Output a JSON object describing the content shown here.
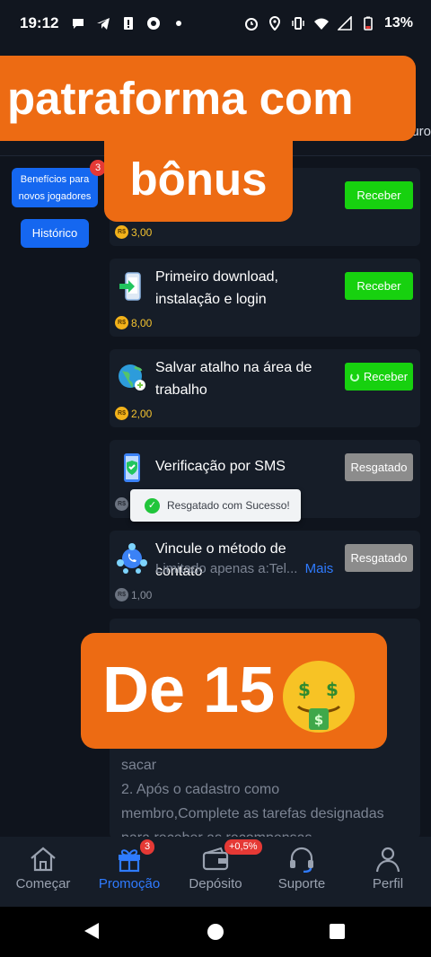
{
  "status_bar": {
    "time": "19:12",
    "battery": "13%",
    "icons_left": [
      "chat-icon",
      "telegram-icon",
      "alert-icon",
      "chrome-icon",
      "dot-icon"
    ],
    "icons_right": [
      "alarm-icon",
      "location-icon",
      "vibrate-icon",
      "wifi-icon",
      "signal-icon",
      "battery-icon"
    ]
  },
  "header": {
    "partial_tab": "uro"
  },
  "overlays": {
    "top_line1": "patraforma com",
    "top_line2": "bônus",
    "middle": "De 15"
  },
  "sidebar": {
    "benefits_label_line1": "Benefícios para",
    "benefits_label_line2": "novos jogadores",
    "benefits_badge": "3",
    "history_label": "Histórico"
  },
  "tasks": [
    {
      "title": "",
      "reward": "3,00",
      "action": "Receber",
      "icon": "task-icon",
      "state": "available"
    },
    {
      "title": "Primeiro download, instalação e login",
      "reward": "8,00",
      "action": "Receber",
      "icon": "download-phone-icon",
      "state": "available"
    },
    {
      "title": "Salvar atalho na área de trabalho",
      "reward": "2,00",
      "action": "Receber",
      "icon": "globe-link-icon",
      "state": "loading"
    },
    {
      "title": "Verificação por SMS",
      "reward": "",
      "action": "Resgatado",
      "icon": "phone-shield-icon",
      "state": "claimed"
    },
    {
      "title": "Vincule o método de contato",
      "subtitle": "Limitado apenas a:Tel...",
      "more": "Mais",
      "reward": "1,00",
      "action": "Resgatado",
      "icon": "contact-network-icon",
      "state": "claimed"
    }
  ],
  "currency_symbol": "R$",
  "toast": {
    "message": "Resgatado com Sucesso!"
  },
  "rules": {
    "line1": "sacar",
    "line2": "2. Após o cadastro como",
    "line3": "membro,Complete as tarefas designadas",
    "line4": "para receber as recompensas"
  },
  "bottom_nav": {
    "items": [
      {
        "label": "Começar",
        "icon": "home-icon"
      },
      {
        "label": "Promoção",
        "icon": "gift-icon",
        "badge": "3",
        "active": true
      },
      {
        "label": "Depósito",
        "icon": "wallet-icon",
        "badge": "+0,5%"
      },
      {
        "label": "Suporte",
        "icon": "headset-icon"
      },
      {
        "label": "Perfil",
        "icon": "user-icon"
      }
    ]
  },
  "colors": {
    "accent_blue": "#2f7bff",
    "action_green": "#17d10f",
    "claimed_gray": "#8c8c8c",
    "overlay_orange": "#ed6b13",
    "coin_gold": "#f2b21a"
  }
}
